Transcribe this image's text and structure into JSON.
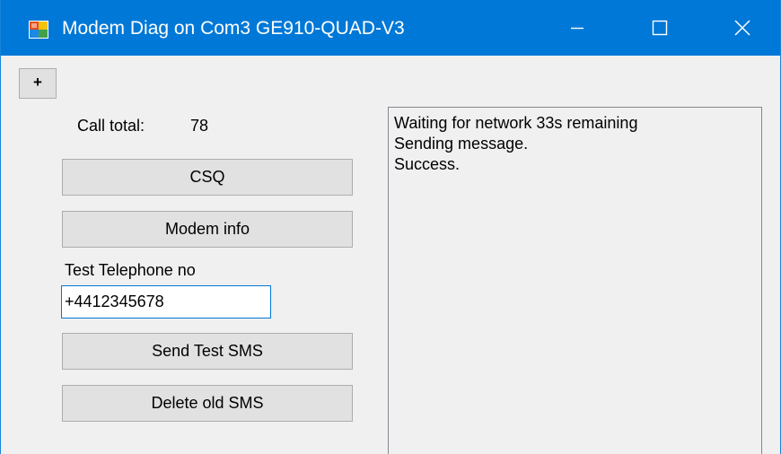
{
  "window": {
    "title": "Modem Diag on Com3 GE910-QUAD-V3",
    "controls": {
      "minimize": "minimize-icon",
      "maximize": "maximize-icon",
      "close": "close-icon"
    }
  },
  "toolbar": {
    "plus_label": "+"
  },
  "stats": {
    "call_total_label": "Call total:",
    "call_total_value": "78"
  },
  "buttons": {
    "csq": "CSQ",
    "modem_info": "Modem info",
    "send_test_sms": "Send Test SMS",
    "delete_old_sms": "Delete old SMS"
  },
  "phone": {
    "label": "Test Telephone no",
    "value": "+4412345678"
  },
  "log": {
    "lines": [
      "Waiting for network 33s remaining",
      "Sending message.",
      "Success."
    ]
  },
  "colors": {
    "titlebar": "#0078d7",
    "window_bg": "#f0f0f0",
    "button_bg": "#e1e1e1",
    "button_border": "#adadad"
  }
}
